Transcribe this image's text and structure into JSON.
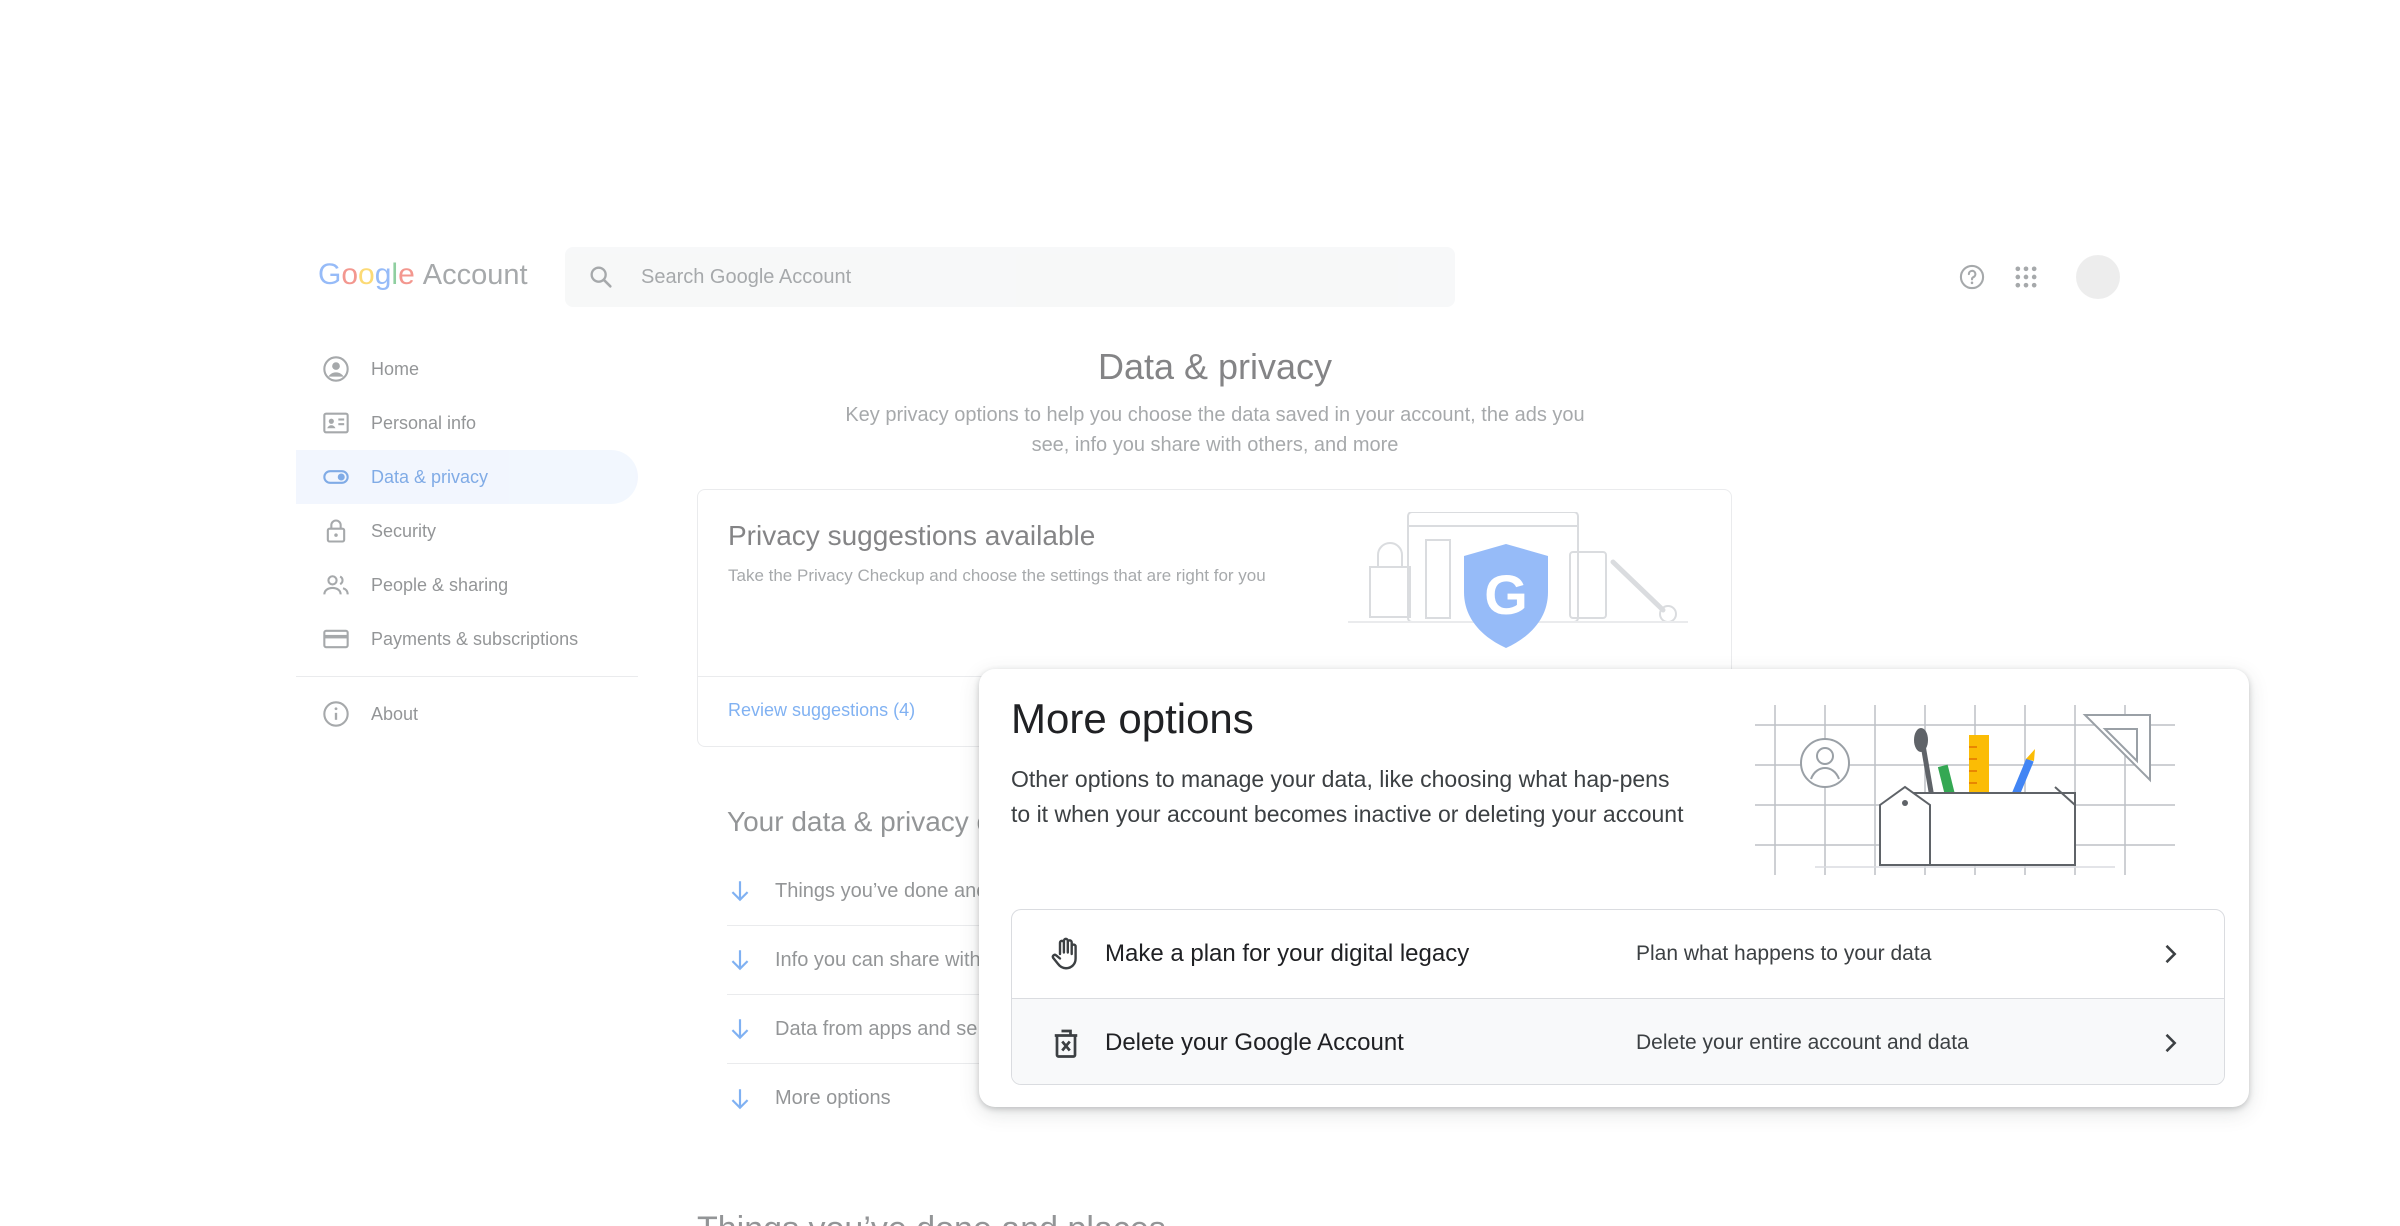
{
  "header": {
    "logo_word": "Google",
    "logo_product": "Account",
    "search_placeholder": "Search Google Account"
  },
  "sidebar": {
    "items": [
      {
        "label": "Home",
        "icon": "account-circle-icon"
      },
      {
        "label": "Personal info",
        "icon": "id-card-icon"
      },
      {
        "label": "Data & privacy",
        "icon": "toggle-icon",
        "active": true
      },
      {
        "label": "Security",
        "icon": "lock-icon"
      },
      {
        "label": "People & sharing",
        "icon": "people-icon"
      },
      {
        "label": "Payments & subscriptions",
        "icon": "credit-card-icon"
      }
    ],
    "about_label": "About"
  },
  "main": {
    "title": "Data & privacy",
    "subtitle": "Key privacy options to help you choose the data saved in your account, the ads you see, info you share with others, and more",
    "privacy_card": {
      "title": "Privacy suggestions available",
      "description": "Take the Privacy Checkup and choose the settings that are right for you",
      "link": "Review suggestions (4)"
    },
    "section_heading": "Your data & privacy c",
    "rows": [
      "Things you’ve done anc",
      "Info you can share with",
      "Data from apps and se",
      "More options"
    ],
    "bottom_heading": "Things you’ve done and places"
  },
  "popup": {
    "title": "More options",
    "description": "Other options to manage your data, like choosing what hap-pens to it when your account becomes inactive or deleting your account",
    "options": [
      {
        "label": "Make a plan for your digital legacy",
        "detail": "Plan what happens to your data",
        "icon": "hand-icon"
      },
      {
        "label": "Delete your Google Account",
        "detail": "Delete your entire account and data",
        "icon": "delete-icon"
      }
    ]
  },
  "colors": {
    "accent": "#1a73e8",
    "active_nav_bg": "#e8f0fe",
    "text_secondary": "#5f6368"
  }
}
